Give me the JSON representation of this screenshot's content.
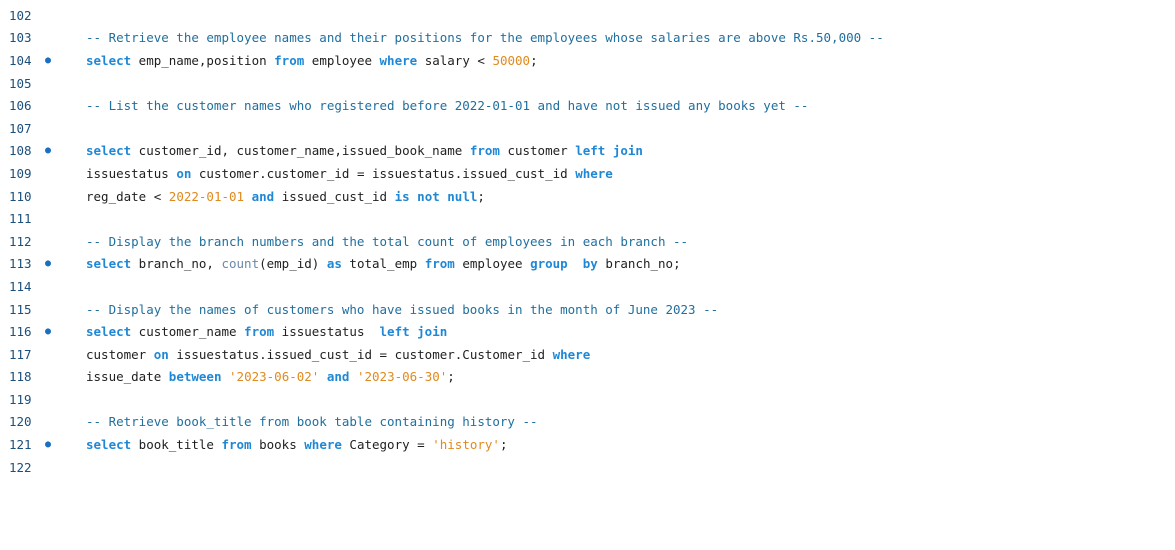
{
  "editor": {
    "lines": [
      {
        "num": "102",
        "marker": "",
        "tokens": []
      },
      {
        "num": "103",
        "marker": "",
        "tokens": [
          {
            "t": "cm",
            "v": "-- Retrieve the employee names and their positions for the employees whose salaries are above Rs.50,000 --"
          }
        ]
      },
      {
        "num": "104",
        "marker": "●",
        "tokens": [
          {
            "t": "kw",
            "v": "select"
          },
          {
            "t": "id",
            "v": " emp_name,position "
          },
          {
            "t": "kw",
            "v": "from"
          },
          {
            "t": "id",
            "v": " employee "
          },
          {
            "t": "kw",
            "v": "where"
          },
          {
            "t": "id",
            "v": " salary < "
          },
          {
            "t": "num",
            "v": "50000"
          },
          {
            "t": "id",
            "v": ";"
          }
        ]
      },
      {
        "num": "105",
        "marker": "",
        "tokens": []
      },
      {
        "num": "106",
        "marker": "",
        "tokens": [
          {
            "t": "cm",
            "v": "-- List the customer names who registered before 2022-01-01 and have not issued any books yet --"
          }
        ]
      },
      {
        "num": "107",
        "marker": "",
        "tokens": []
      },
      {
        "num": "108",
        "marker": "●",
        "tokens": [
          {
            "t": "kw",
            "v": "select"
          },
          {
            "t": "id",
            "v": " customer_id, customer_name,issued_book_name "
          },
          {
            "t": "kw",
            "v": "from"
          },
          {
            "t": "id",
            "v": " customer "
          },
          {
            "t": "kw",
            "v": "left join"
          }
        ]
      },
      {
        "num": "109",
        "marker": "",
        "tokens": [
          {
            "t": "id",
            "v": "issuestatus "
          },
          {
            "t": "kw",
            "v": "on"
          },
          {
            "t": "id",
            "v": " customer.customer_id = issuestatus.issued_cust_id "
          },
          {
            "t": "kw",
            "v": "where"
          }
        ]
      },
      {
        "num": "110",
        "marker": "",
        "tokens": [
          {
            "t": "id",
            "v": "reg_date < "
          },
          {
            "t": "num",
            "v": "2022-01-01"
          },
          {
            "t": "id",
            "v": " "
          },
          {
            "t": "kw",
            "v": "and"
          },
          {
            "t": "id",
            "v": " issued_cust_id "
          },
          {
            "t": "kw",
            "v": "is not null"
          },
          {
            "t": "id",
            "v": ";"
          }
        ]
      },
      {
        "num": "111",
        "marker": "",
        "tokens": []
      },
      {
        "num": "112",
        "marker": "",
        "tokens": [
          {
            "t": "cm",
            "v": "-- Display the branch numbers and the total count of employees in each branch --"
          }
        ]
      },
      {
        "num": "113",
        "marker": "●",
        "tokens": [
          {
            "t": "kw",
            "v": "select"
          },
          {
            "t": "id",
            "v": " branch_no, "
          },
          {
            "t": "fn",
            "v": "count"
          },
          {
            "t": "id",
            "v": "(emp_id) "
          },
          {
            "t": "kw",
            "v": "as"
          },
          {
            "t": "id",
            "v": " total_emp "
          },
          {
            "t": "kw",
            "v": "from"
          },
          {
            "t": "id",
            "v": " employee "
          },
          {
            "t": "kw",
            "v": "group  by"
          },
          {
            "t": "id",
            "v": " branch_no;"
          }
        ]
      },
      {
        "num": "114",
        "marker": "",
        "tokens": []
      },
      {
        "num": "115",
        "marker": "",
        "tokens": [
          {
            "t": "cm",
            "v": "-- Display the names of customers who have issued books in the month of June 2023 --"
          }
        ]
      },
      {
        "num": "116",
        "marker": "●",
        "tokens": [
          {
            "t": "kw",
            "v": "select"
          },
          {
            "t": "id",
            "v": " customer_name "
          },
          {
            "t": "kw",
            "v": "from"
          },
          {
            "t": "id",
            "v": " issuestatus  "
          },
          {
            "t": "kw",
            "v": "left join"
          }
        ]
      },
      {
        "num": "117",
        "marker": "",
        "tokens": [
          {
            "t": "id",
            "v": "customer "
          },
          {
            "t": "kw",
            "v": "on"
          },
          {
            "t": "id",
            "v": " issuestatus.issued_cust_id = customer.Customer_id "
          },
          {
            "t": "kw",
            "v": "where"
          }
        ]
      },
      {
        "num": "118",
        "marker": "",
        "tokens": [
          {
            "t": "id",
            "v": "issue_date "
          },
          {
            "t": "kw",
            "v": "between"
          },
          {
            "t": "id",
            "v": " "
          },
          {
            "t": "str",
            "v": "'2023-06-02'"
          },
          {
            "t": "id",
            "v": " "
          },
          {
            "t": "kw",
            "v": "and"
          },
          {
            "t": "id",
            "v": " "
          },
          {
            "t": "str",
            "v": "'2023-06-30'"
          },
          {
            "t": "id",
            "v": ";"
          }
        ]
      },
      {
        "num": "119",
        "marker": "",
        "tokens": []
      },
      {
        "num": "120",
        "marker": "",
        "tokens": [
          {
            "t": "cm",
            "v": "-- Retrieve book_title from book table containing history --"
          }
        ]
      },
      {
        "num": "121",
        "marker": "●",
        "tokens": [
          {
            "t": "kw",
            "v": "select"
          },
          {
            "t": "id",
            "v": " book_title "
          },
          {
            "t": "kw",
            "v": "from"
          },
          {
            "t": "id",
            "v": " books "
          },
          {
            "t": "kw",
            "v": "where"
          },
          {
            "t": "id",
            "v": " Category = "
          },
          {
            "t": "str",
            "v": "'history'"
          },
          {
            "t": "id",
            "v": ";"
          }
        ]
      },
      {
        "num": "122",
        "marker": "",
        "tokens": []
      }
    ]
  }
}
